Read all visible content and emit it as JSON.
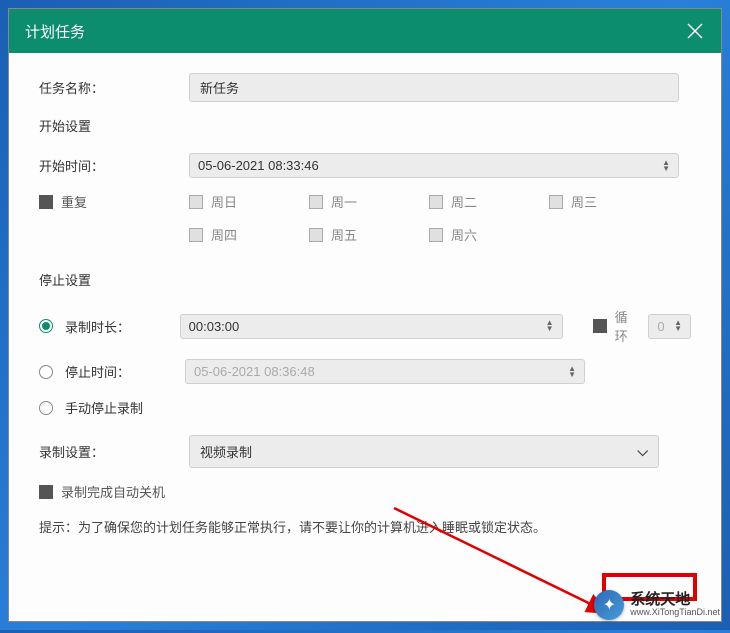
{
  "window": {
    "title": "计划任务"
  },
  "task": {
    "name_label": "任务名称：",
    "name_value": "新任务"
  },
  "start_section": {
    "title": "开始设置",
    "time_label": "开始时间：",
    "time_value": "05-06-2021 08:33:46",
    "repeat_label": "重复",
    "days": [
      "周日",
      "周一",
      "周二",
      "周三",
      "周四",
      "周五",
      "周六"
    ]
  },
  "stop_section": {
    "title": "停止设置",
    "duration_label": "录制时长：",
    "duration_value": "00:03:00",
    "loop_label": "循环",
    "loop_value": "0",
    "stoptime_label": "停止时间：",
    "stoptime_value": "05-06-2021 08:36:48",
    "manual_label": "手动停止录制"
  },
  "record_section": {
    "label": "录制设置：",
    "mode": "视频录制",
    "auto_shutdown": "录制完成自动关机"
  },
  "hint": "提示：为了确保您的计划任务能够正常执行，请不要让你的计算机进入睡眠或锁定状态。",
  "watermark": {
    "main": "系统天地",
    "sub": "www.XiTongTianDi.net"
  }
}
